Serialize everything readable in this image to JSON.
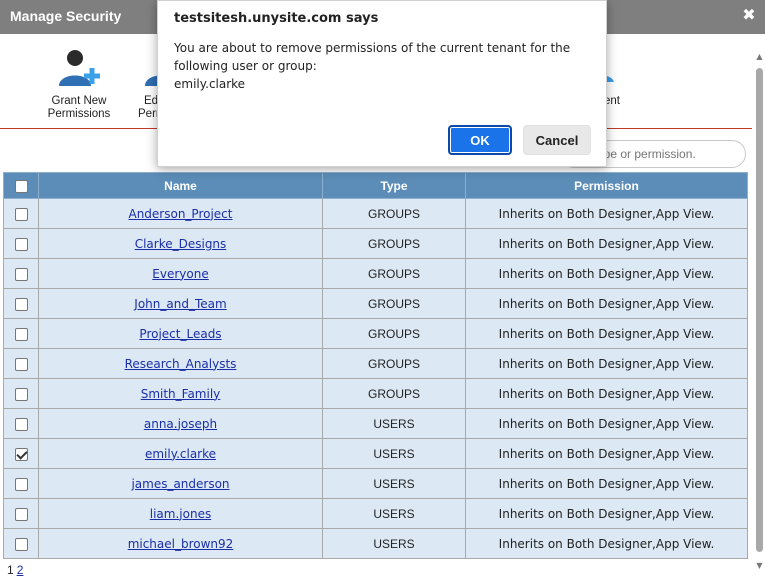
{
  "window": {
    "title": "Manage Security",
    "close_icon": "close-icon"
  },
  "toolbar": {
    "items": [
      {
        "label": "Grant New Permissions",
        "icon": "user-add-icon"
      },
      {
        "label": "Ed… Pern…",
        "icon": "user-edit-icon",
        "visible_text_line1": "Ed",
        "visible_text_line2": "Pern"
      },
      {
        "label": "…ent",
        "icon": "manage-icon",
        "visible_text": "ent"
      }
    ]
  },
  "search": {
    "placeholder": "me, type or permission."
  },
  "table": {
    "headers": {
      "name": "Name",
      "type": "Type",
      "permission": "Permission"
    },
    "rows": [
      {
        "name": "Anderson_Project",
        "type": "GROUPS",
        "permission": "Inherits on Both Designer,App View.",
        "checked": false
      },
      {
        "name": "Clarke_Designs",
        "type": "GROUPS",
        "permission": "Inherits on Both Designer,App View.",
        "checked": false
      },
      {
        "name": "Everyone",
        "type": "GROUPS",
        "permission": "Inherits on Both Designer,App View.",
        "checked": false
      },
      {
        "name": "John_and_Team",
        "type": "GROUPS",
        "permission": "Inherits on Both Designer,App View.",
        "checked": false
      },
      {
        "name": "Project_Leads",
        "type": "GROUPS",
        "permission": "Inherits on Both Designer,App View.",
        "checked": false
      },
      {
        "name": "Research_Analysts",
        "type": "GROUPS",
        "permission": "Inherits on Both Designer,App View.",
        "checked": false
      },
      {
        "name": "Smith_Family",
        "type": "GROUPS",
        "permission": "Inherits on Both Designer,App View.",
        "checked": false
      },
      {
        "name": "anna.joseph",
        "type": "USERS",
        "permission": "Inherits on Both Designer,App View.",
        "checked": false
      },
      {
        "name": "emily.clarke",
        "type": "USERS",
        "permission": "Inherits on Both Designer,App View.",
        "checked": true
      },
      {
        "name": "james_anderson",
        "type": "USERS",
        "permission": "Inherits on Both Designer,App View.",
        "checked": false
      },
      {
        "name": "liam.jones",
        "type": "USERS",
        "permission": "Inherits on Both Designer,App View.",
        "checked": false
      },
      {
        "name": "michael_brown92",
        "type": "USERS",
        "permission": "Inherits on Both Designer,App View.",
        "checked": false
      }
    ]
  },
  "pager": {
    "current": "1",
    "other": "2"
  },
  "dialog": {
    "title": "testsitesh.unysite.com says",
    "message_line1": "You are about to remove permissions of the current tenant for the following user or group:",
    "message_line2": "emily.clarke",
    "ok_label": "OK",
    "cancel_label": "Cancel"
  },
  "colors": {
    "header": "#5b8db8",
    "row": "#dce9f4",
    "titlebar": "#7f7f7f",
    "accent": "#1a73e8",
    "divider": "#c0392b"
  }
}
